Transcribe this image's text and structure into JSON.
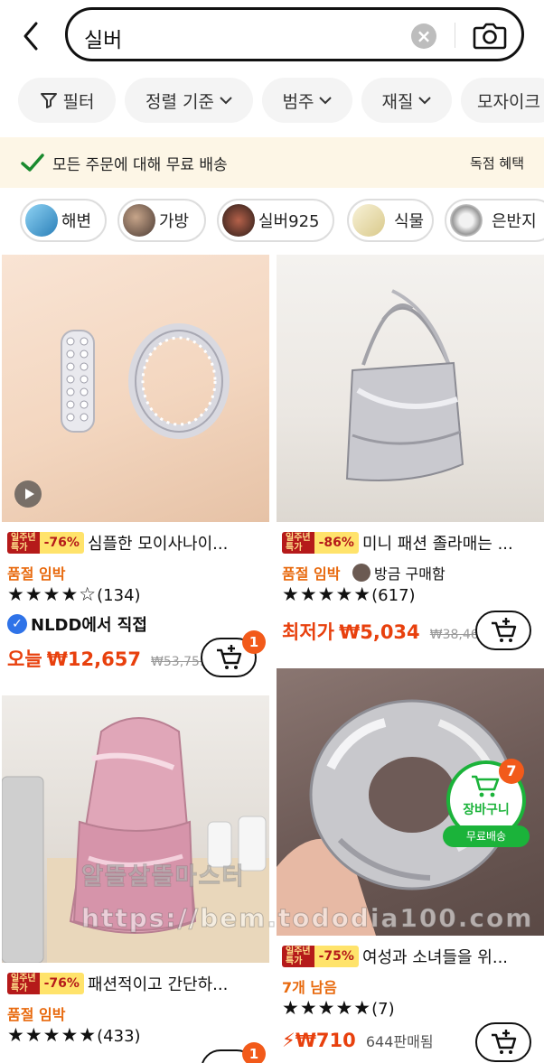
{
  "search": {
    "query": "실버"
  },
  "filters": [
    {
      "label": "필터"
    },
    {
      "label": "정렬 기준"
    },
    {
      "label": "범주"
    },
    {
      "label": "재질"
    },
    {
      "label": "모자이크"
    }
  ],
  "banner": {
    "text": "모든 주문에 대해 무료 배송",
    "link": "독점 혜택"
  },
  "categories": [
    {
      "label": "해변"
    },
    {
      "label": "가방"
    },
    {
      "label": "실버925"
    },
    {
      "label": "식물"
    },
    {
      "label": "은반지"
    }
  ],
  "promo_label": "일주년 특가",
  "products": [
    {
      "discount": "-76%",
      "title": "심플한 모이사나이...",
      "status": "품절 임박",
      "rating": 4.5,
      "stars": "★★★★☆",
      "reviews": "(134)",
      "seller": "NLDD에서 직접",
      "price_label": "오늘",
      "price": "₩12,657",
      "old_price": "₩53,759",
      "cart_count": "1"
    },
    {
      "discount": "-86%",
      "title": "미니 패션 졸라매는 ...",
      "status": "품절 임박",
      "buyer_text": "방금 구매함",
      "rating": 4.5,
      "stars": "★★★★★",
      "reviews": "(617)",
      "price_label": "최저가",
      "price": "₩5,034",
      "old_price": "₩38,467"
    },
    {
      "discount": "-76%",
      "title": "패션적이고 간단하...",
      "status": "품절 임박",
      "rating": 4.5,
      "stars": "★★★★★",
      "reviews": "(433)",
      "cart_count": "1"
    },
    {
      "discount": "-75%",
      "title": "여성과 소녀들을 위...",
      "status": "7개 남음",
      "rating": 5,
      "stars": "★★★★★",
      "reviews": "(7)",
      "price": "₩710",
      "sold": "644판매됨"
    }
  ],
  "floating_cart": {
    "label": "장바구니",
    "free": "무료배송",
    "count": "7"
  },
  "watermark": {
    "line1": "알뜰살뜰마스터",
    "line2": "https://bem.tododia100.com"
  },
  "colors": {
    "accent": "#e8400d",
    "green": "#1bb33a",
    "badge": "#f25a1a",
    "banner_bg": "#fdf6e6"
  }
}
